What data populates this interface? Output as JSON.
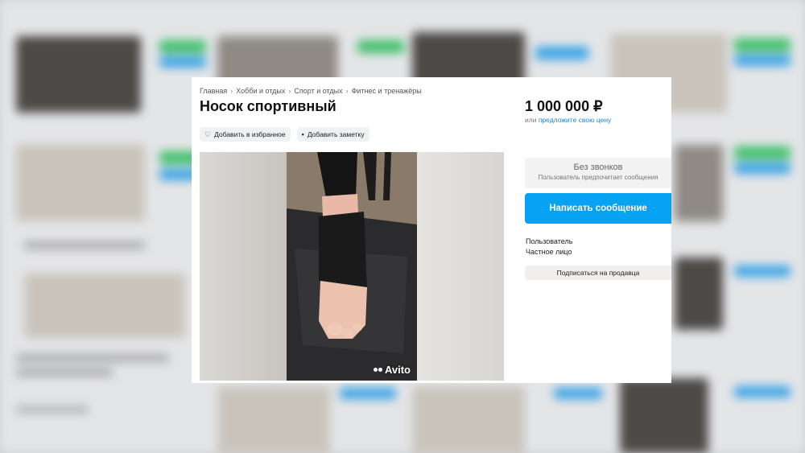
{
  "breadcrumb": [
    "Главная",
    "Хобби и отдых",
    "Спорт и отдых",
    "Фитнес и тренажёры"
  ],
  "breadcrumb_separator": "›",
  "listing": {
    "title": "Носок спортивный",
    "price": "1 000 000 ₽",
    "price_prefix": "или",
    "price_link": "предложите свою цену"
  },
  "actions": {
    "favorite_label": "Добавить в избранное",
    "favorite_icon": "heart-icon",
    "note_label": "Добавить заметку",
    "note_icon": "note-icon"
  },
  "gallery": {
    "watermark": "Avito"
  },
  "contact": {
    "no_calls_title": "Без звонков",
    "no_calls_subtitle": "Пользователь предпочитает сообщения",
    "write_button": "Написать сообщение"
  },
  "seller": {
    "label": "Пользователь",
    "type": "Частное лицо",
    "subscribe_button": "Подписаться на продавца"
  },
  "colors": {
    "accent_blue": "#08a2f2",
    "link_blue": "#1a8ad8"
  }
}
